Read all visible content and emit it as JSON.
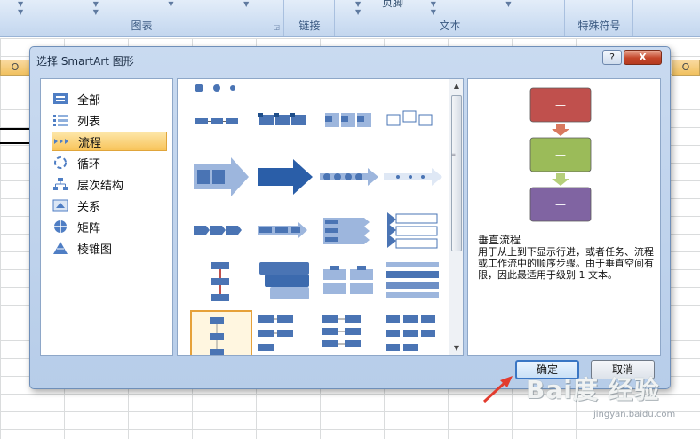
{
  "ribbon": {
    "groups": [
      {
        "label": "图表"
      },
      {
        "label": "链接"
      },
      {
        "label": "文本",
        "top_word": "页脚"
      },
      {
        "label": "特殊符号"
      }
    ]
  },
  "sheet": {
    "col_heads": [
      "O",
      "O"
    ]
  },
  "dialog": {
    "title": "选择 SmartArt 图形",
    "help_label": "?",
    "close_label": "X",
    "categories": [
      {
        "label": "全部",
        "icon": "all-icon"
      },
      {
        "label": "列表",
        "icon": "list-icon"
      },
      {
        "label": "流程",
        "icon": "process-icon",
        "selected": true
      },
      {
        "label": "循环",
        "icon": "cycle-icon"
      },
      {
        "label": "层次结构",
        "icon": "hierarchy-icon"
      },
      {
        "label": "关系",
        "icon": "relationship-icon"
      },
      {
        "label": "矩阵",
        "icon": "matrix-icon"
      },
      {
        "label": "棱锥图",
        "icon": "pyramid-icon"
      }
    ],
    "preview": {
      "name": "垂直流程",
      "description": "用于从上到下显示行进，或者任务、流程或工作流中的顺序步骤。由于垂直空间有限，因此最适用于级别 1 文本。",
      "box_colors": [
        "#c0504d",
        "#9bbb59",
        "#8064a2"
      ],
      "placeholder": "—"
    },
    "ok_label": "确定",
    "cancel_label": "取消",
    "selected_layout_index": 16
  },
  "watermark": {
    "logo": "Bai度 经验",
    "sub": "jingyan.baidu.com"
  },
  "colors": {
    "accent_orange": "#f3b74f",
    "arrow_red": "#e23b2e",
    "smartart_blue": "#4a74b4"
  }
}
